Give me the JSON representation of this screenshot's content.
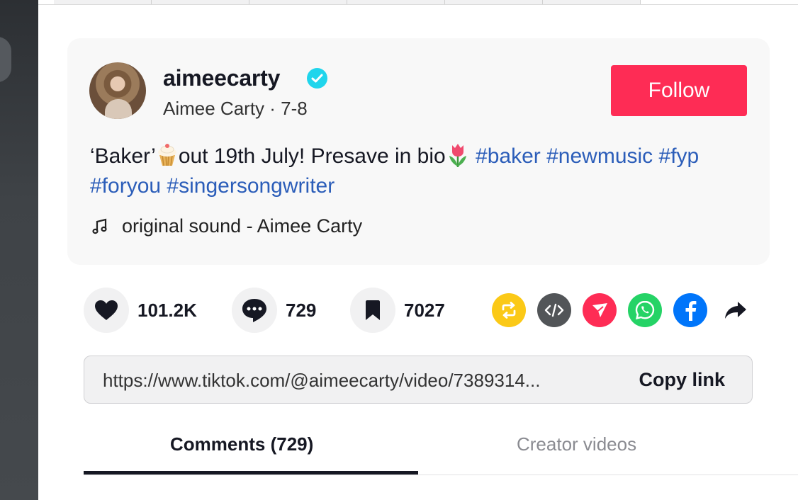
{
  "video_info": {
    "username": "aimeecarty",
    "display_name": "Aimee Carty",
    "separator": " · ",
    "date": "7-8",
    "follow_label": "Follow",
    "caption_text": "‘Baker’",
    "caption_text_2": "out 19th July! Presave in bio",
    "hashtags": [
      "#baker",
      "#newmusic",
      "#fyp",
      "#foryou",
      "#singersongwriter"
    ],
    "music": "original sound - Aimee Carty"
  },
  "actions": {
    "likes": "101.2K",
    "comments": "729",
    "saves": "7027"
  },
  "share": {
    "icons": [
      "repost-icon",
      "embed-icon",
      "send-icon",
      "whatsapp-icon",
      "facebook-icon",
      "share-arrow-icon"
    ],
    "colors": {
      "repost": "#fbc917",
      "embed": "#525558",
      "send": "#fe2c55",
      "whatsapp": "#25d366",
      "facebook": "#0075fa"
    }
  },
  "link": {
    "url": "https://www.tiktok.com/@aimeecarty/video/7389314...",
    "copy_label": "Copy link"
  },
  "tabs": {
    "comments": "Comments (729)",
    "creator": "Creator videos"
  },
  "colors": {
    "accent": "#fe2c55",
    "hashtag": "#2b5db9",
    "verified": "#20d5ec"
  }
}
